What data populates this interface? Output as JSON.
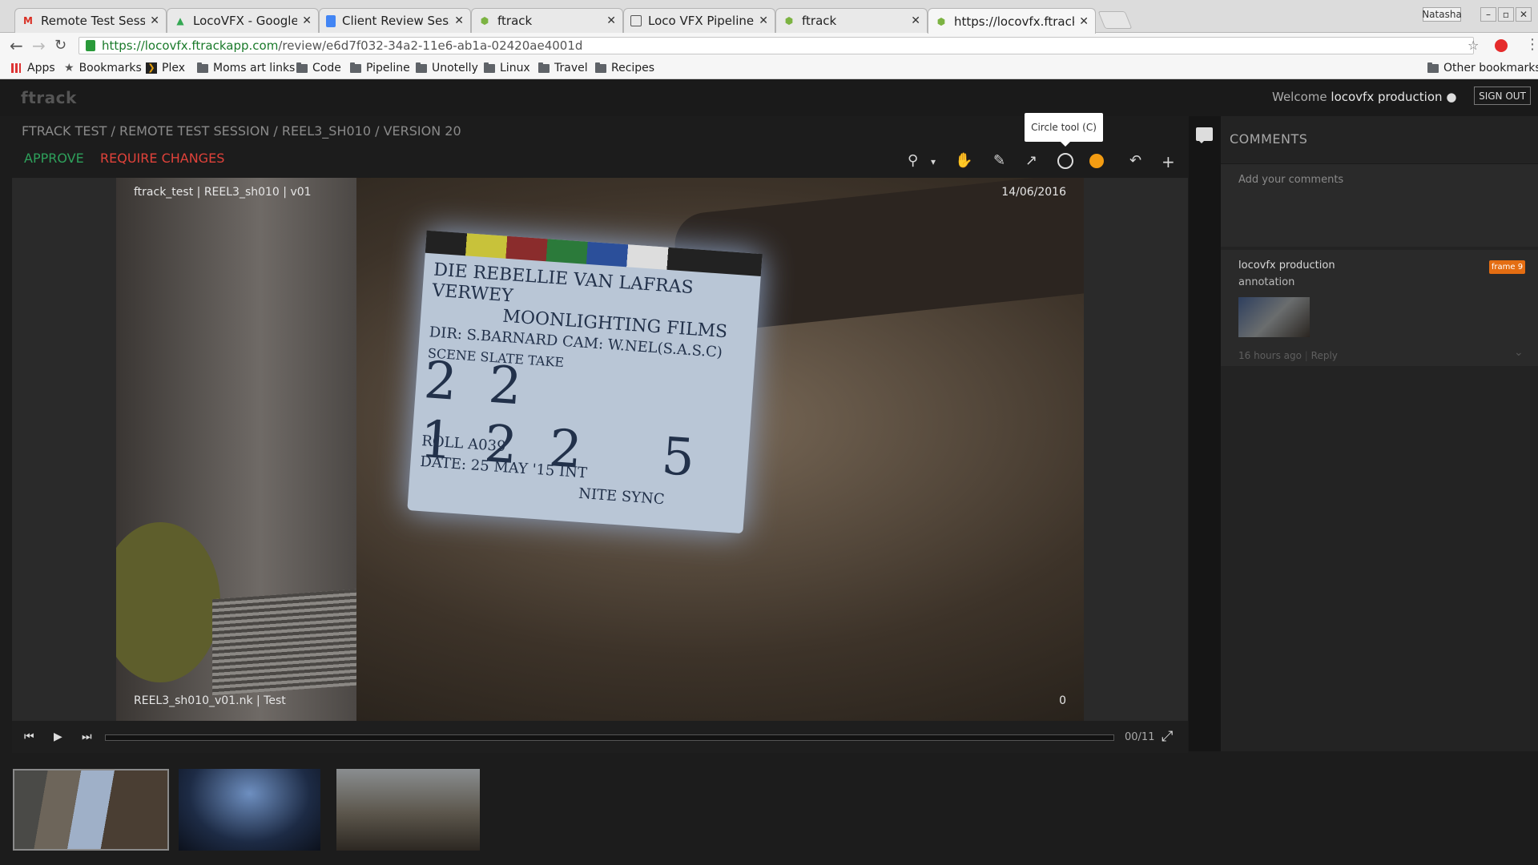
{
  "browser": {
    "tabs": [
      {
        "title": "Remote Test Session",
        "icon": "gmail-icon",
        "color": "#d93025"
      },
      {
        "title": "LocoVFX - Google Dr",
        "icon": "drive-icon",
        "color": "#34a853"
      },
      {
        "title": "Client Review Sessio",
        "icon": "docs-icon",
        "color": "#4285f4"
      },
      {
        "title": "ftrack",
        "icon": "ftrack-icon",
        "color": "#7cb342"
      },
      {
        "title": "Loco VFX Pipeline Dc",
        "icon": "doc-icon",
        "color": "#555555"
      },
      {
        "title": "ftrack",
        "icon": "ftrack-icon",
        "color": "#7cb342"
      },
      {
        "title": "https://locovfx.ftrack",
        "icon": "ftrack-icon",
        "color": "#7cb342"
      }
    ],
    "user_label": "Natasha",
    "url_host": "https://locovfx.ftrackapp.com",
    "url_path": "/review/e6d7f032-34a2-11e6-ab1a-02420ae4001d",
    "bookmarks": [
      {
        "label": "Apps",
        "icon": "apps-grid-icon"
      },
      {
        "label": "Bookmarks",
        "icon": "star-icon"
      },
      {
        "label": "Plex",
        "icon": "plex-icon"
      },
      {
        "label": "Moms art links",
        "icon": "folder-icon"
      },
      {
        "label": "Code",
        "icon": "folder-icon"
      },
      {
        "label": "Pipeline",
        "icon": "folder-icon"
      },
      {
        "label": "Unotelly",
        "icon": "folder-icon"
      },
      {
        "label": "Linux",
        "icon": "folder-icon"
      },
      {
        "label": "Travel",
        "icon": "folder-icon"
      },
      {
        "label": "Recipes",
        "icon": "folder-icon"
      }
    ],
    "other_bookmarks": "Other bookmarks"
  },
  "app": {
    "logo": "ftrack",
    "welcome_prefix": "Welcome",
    "welcome_user": "locovfx production",
    "sign_out": "SIGN OUT",
    "breadcrumb": "FTRACK TEST / REMOTE TEST SESSION / REEL3_SH010 / VERSION 20",
    "approve": "APPROVE",
    "require_changes": "REQUIRE CHANGES",
    "tooltip": "Circle tool (C)",
    "annotation_color": "#f39c12",
    "accent_approve": "#2ea05b",
    "accent_reject": "#e0423a"
  },
  "player": {
    "top_left": "ftrack_test  |  REEL3_sh010 | v01",
    "top_right": "14/06/2016",
    "bottom_left": "REEL3_sh010_v01.nk  |  Test",
    "bottom_right": "0",
    "frame_counter": "00/11",
    "progress": 0
  },
  "slate": {
    "line1": "DIE REBELLIE VAN LAFRAS VERWEY",
    "line2": "MOONLIGHTING FILMS",
    "line3": "DIR: S.BARNARD   CAM: W.NEL(S.A.S.C)",
    "line4": "SCENE     SLATE     TAKE",
    "numbers": "22 122 5",
    "line5": "ROLL A039",
    "line6": "DATE: 25 MAY '15    INT",
    "line7": "NITE          SYNC"
  },
  "comments": {
    "header": "COMMENTS",
    "placeholder": "Add your comments",
    "items": [
      {
        "author": "locovfx production",
        "body": "annotation",
        "badge": "frame 9",
        "time": "16 hours ago",
        "reply": "Reply"
      }
    ]
  }
}
